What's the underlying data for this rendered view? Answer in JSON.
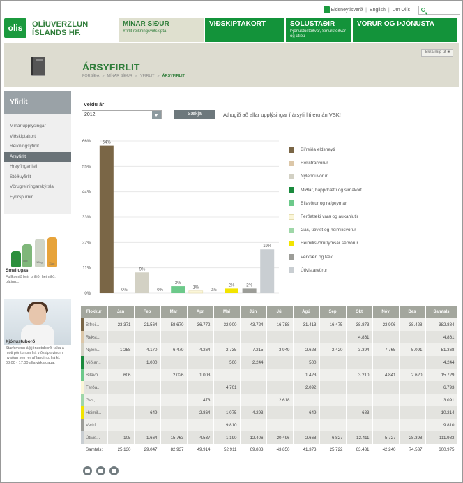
{
  "utility": {
    "gas_station": "Eldsneytisverð",
    "english": "English",
    "about": "Um Olís",
    "sep": "|"
  },
  "logo": {
    "mark": "olis",
    "line1": "OLÍUVERZLUN",
    "line2": "ÍSLANDS HF."
  },
  "nav": [
    {
      "label": "MÍNAR SÍÐUR",
      "sub": "Yfirlit reikningsviðskipta",
      "active": true
    },
    {
      "label": "VIÐSKIPTAKORT",
      "sub": "",
      "active": false
    },
    {
      "label": "SÖLUSTAÐIR",
      "sub": "Þjónustustöðvar, Smurstöðvar og útibú",
      "active": false
    },
    {
      "label": "VÖRUR OG ÞJÓNUSTA",
      "sub": "",
      "active": false
    }
  ],
  "banner": {
    "title": "ÁRSYFIRLIT",
    "crumbs": [
      "FORSÍÐA",
      "»",
      "MÍNAR SÍÐUR",
      "»",
      "YFIRLIT",
      "»",
      "ÁRSYFIRLIT"
    ],
    "logout": "Skrá mig út"
  },
  "sidebar": {
    "heading": "Yfirlit",
    "items": [
      {
        "label": "Mínar upplýsingar",
        "active": false
      },
      {
        "label": "Viðskiptakort",
        "active": false
      },
      {
        "label": "Reikningsyfirlit",
        "active": false
      },
      {
        "label": "Ársyfirlit",
        "active": true
      },
      {
        "label": "Hreyfingarlisti",
        "active": false
      },
      {
        "label": "Stöðuyfirlit",
        "active": false
      },
      {
        "label": "Vörugreiningarskýrsla",
        "active": false
      },
      {
        "label": "Fyrirspurnir",
        "active": false
      }
    ],
    "promo1": {
      "title": "Smellugas",
      "text": "Fullkomið fyrir grillið, heimilið, bátinn...",
      "tank_labels": [
        "2kg",
        "5kg",
        "10kg",
        "11kg"
      ]
    },
    "promo2": {
      "title": "Þjónustuborð",
      "text": "Starfsmenn á þjónustuborði taka á móti pöntunum frá viðskiptavinum, hvaðan sem er af landinu, frá kl. 08:00 - 17:00 alla virka daga."
    }
  },
  "form": {
    "year_label": "Veldu ár",
    "year_value": "2012",
    "submit": "Sækja",
    "note": "Athugið að allar upplýsingar í ársyfirliti eru án VSK!"
  },
  "chart_data": {
    "type": "bar",
    "ylim": [
      0,
      66
    ],
    "yticks": [
      "0%",
      "11%",
      "22%",
      "33%",
      "44%",
      "55%",
      "66%"
    ],
    "grid": true,
    "legend_position": "right",
    "categories": [
      "Bifreiða eldsneyti",
      "Rekstrarvörur",
      "Nýlenduvörur",
      "Miðlar, happdrætti og símakort",
      "Bílavörur og rafgeymar",
      "Ferðatæki vara og aukahlutir",
      "Gas, útivist og heimilisvörur",
      "Heimilisvörur/ýmsar sérvörur",
      "Verkfæri og tæki",
      "Útivistarvörur"
    ],
    "values": [
      64,
      0,
      9,
      0,
      3,
      1,
      0,
      2,
      2,
      19
    ],
    "value_labels": [
      "64%",
      "0%",
      "9%",
      "0%",
      "3%",
      "1%",
      "0%",
      "2%",
      "2%",
      "19%"
    ],
    "colors": [
      "#7a6646",
      "#dcc7a8",
      "#d3d1c4",
      "#1a8a3d",
      "#6cc98a",
      "#fbf6d8",
      "#9fd7a8",
      "#f2e400",
      "#9c9d98",
      "#c9ced2"
    ]
  },
  "table": {
    "headers": [
      "Flokkur",
      "Jan",
      "Feb",
      "Mar",
      "Apr",
      "Maí",
      "Jún",
      "Júl",
      "Ágú",
      "Sep",
      "Okt",
      "Nóv",
      "Des",
      "Samtals"
    ],
    "rows": [
      {
        "cat": "Bifrei...",
        "color": "#7a6646",
        "cells": [
          "23.371",
          "21.564",
          "58.670",
          "36.772",
          "32.900",
          "43.724",
          "16.788",
          "31.413",
          "16.475",
          "38.873",
          "23.906",
          "38.428",
          "382.884"
        ]
      },
      {
        "cat": "Rekst...",
        "color": "#dcc7a8",
        "cells": [
          "",
          "",
          "",
          "",
          "",
          "",
          "",
          "",
          "",
          "4.861",
          "",
          "",
          "4.861"
        ]
      },
      {
        "cat": "Nýlen...",
        "color": "#d3d1c4",
        "cells": [
          "1.258",
          "4.170",
          "6.479",
          "4.264",
          "2.735",
          "7.215",
          "3.949",
          "2.628",
          "2.420",
          "3.394",
          "7.765",
          "5.091",
          "51.368"
        ]
      },
      {
        "cat": "Miðlar...",
        "color": "#1a8a3d",
        "cells": [
          "",
          "1.000",
          "",
          "",
          "500",
          "2.244",
          "",
          "500",
          "",
          "",
          "",
          "",
          "4.244"
        ]
      },
      {
        "cat": "Bílavö...",
        "color": "#6cc98a",
        "cells": [
          "606",
          "",
          "2.026",
          "1.003",
          "",
          "",
          "",
          "1.423",
          "",
          "3.210",
          "4.841",
          "2.620",
          "15.729"
        ]
      },
      {
        "cat": "Ferða...",
        "color": "#fbf6d8",
        "cells": [
          "",
          "",
          "",
          "",
          "4.701",
          "",
          "",
          "2.092",
          "",
          "",
          "",
          "",
          "6.793"
        ]
      },
      {
        "cat": "Gas, ...",
        "color": "#9fd7a8",
        "cells": [
          "",
          "",
          "",
          "473",
          "",
          "",
          "2.618",
          "",
          "",
          "",
          "",
          "",
          "3.091"
        ]
      },
      {
        "cat": "Heimil...",
        "color": "#f2e400",
        "cells": [
          "",
          "649",
          "",
          "2.864",
          "1.075",
          "4.293",
          "",
          "649",
          "",
          "683",
          "",
          "",
          "10.214"
        ]
      },
      {
        "cat": "Verkf...",
        "color": "#9c9d98",
        "cells": [
          "",
          "",
          "",
          "",
          "9.810",
          "",
          "",
          "",
          "",
          "",
          "",
          "",
          "9.810"
        ]
      },
      {
        "cat": "Útivis...",
        "color": "#c9ced2",
        "cells": [
          "-105",
          "1.664",
          "15.763",
          "4.537",
          "1.190",
          "12.406",
          "20.496",
          "2.668",
          "6.827",
          "12.411",
          "5.727",
          "28.398",
          "111.983"
        ]
      }
    ],
    "sum_label": "Samtals:",
    "sums": [
      "25.130",
      "29.047",
      "82.937",
      "49.914",
      "52.911",
      "69.883",
      "43.850",
      "41.373",
      "25.722",
      "63.431",
      "42.240",
      "74.537",
      "600.975"
    ]
  },
  "actions": [
    "print-icon",
    "email-icon",
    "excel-icon"
  ]
}
